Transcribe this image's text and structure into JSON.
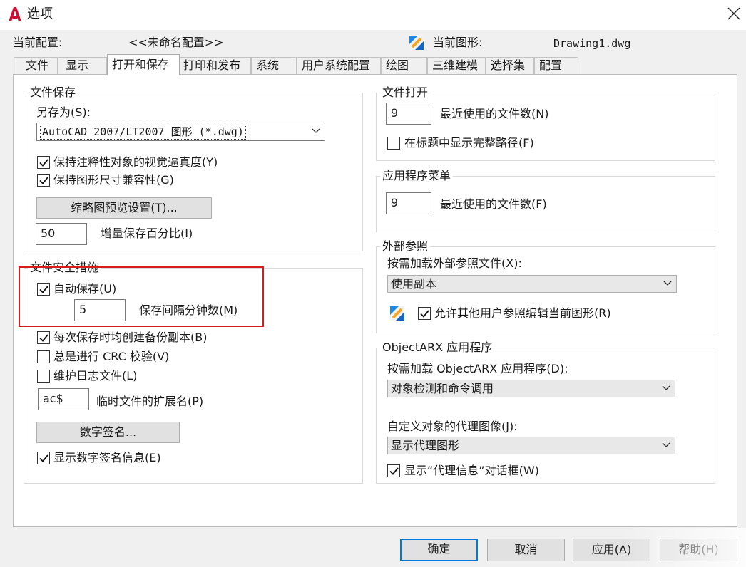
{
  "window": {
    "title": "选项",
    "close_icon": "close-icon"
  },
  "header": {
    "current_profile_label": "当前配置:",
    "current_profile_value": "<<未命名配置>>",
    "current_drawing_label": "当前图形:",
    "current_drawing_value": "Drawing1.dwg"
  },
  "tabs": [
    {
      "label": "文件"
    },
    {
      "label": "显示"
    },
    {
      "label": "打开和保存",
      "active": true
    },
    {
      "label": "打印和发布"
    },
    {
      "label": "系统"
    },
    {
      "label": "用户系统配置"
    },
    {
      "label": "绘图"
    },
    {
      "label": "三维建模"
    },
    {
      "label": "选择集"
    },
    {
      "label": "配置"
    }
  ],
  "file_save": {
    "title": "文件保存",
    "save_as_label": "另存为(S):",
    "save_as_value": "AutoCAD 2007/LT2007 图形 (*.dwg)",
    "maintain_visual_fidelity": {
      "label": "保持注释性对象的视觉逼真度(Y)",
      "checked": true
    },
    "maintain_drawing_size": {
      "label": "保持图形尺寸兼容性(G)",
      "checked": true
    },
    "thumbnail_button": "缩略图预览设置(T)...",
    "incremental_value": "50",
    "incremental_label": "增量保存百分比(I)"
  },
  "file_safety": {
    "title": "文件安全措施",
    "autosave": {
      "label": "自动保存(U)",
      "checked": true
    },
    "interval_value": "5",
    "interval_label": "保存间隔分钟数(M)",
    "backup_copy": {
      "label": "每次保存时均创建备份副本(B)",
      "checked": true
    },
    "crc_check": {
      "label": "总是进行 CRC 校验(V)",
      "checked": false
    },
    "log_file": {
      "label": "维护日志文件(L)",
      "checked": false
    },
    "temp_ext_value": "ac$",
    "temp_ext_label": "临时文件的扩展名(P)",
    "digital_signature_button": "数字签名...",
    "show_signature_info": {
      "label": "显示数字签名信息(E)",
      "checked": true
    }
  },
  "file_open": {
    "title": "文件打开",
    "recent_count_value": "9",
    "recent_count_label": "最近使用的文件数(N)",
    "full_path": {
      "label": "在标题中显示完整路径(F)",
      "checked": false
    }
  },
  "app_menu": {
    "title": "应用程序菜单",
    "recent_count_value": "9",
    "recent_count_label": "最近使用的文件数(F)"
  },
  "xref": {
    "title": "外部参照",
    "demand_load_label": "按需加载外部参照文件(X):",
    "demand_load_value": "使用副本",
    "allow_edit": {
      "label": "允许其他用户参照编辑当前图形(R)",
      "checked": true
    }
  },
  "objectarx": {
    "title": "ObjectARX 应用程序",
    "demand_load_label": "按需加载 ObjectARX 应用程序(D):",
    "demand_load_value": "对象检测和命令调用",
    "proxy_images_label": "自定义对象的代理图像(J):",
    "proxy_images_value": "显示代理图形",
    "show_proxy_dialog": {
      "label": "显示“代理信息”对话框(W)",
      "checked": true
    }
  },
  "footer": {
    "ok": "确定",
    "cancel": "取消",
    "apply": "应用(A)",
    "help": "帮助(H)"
  },
  "colors": {
    "accent": "#0078d7",
    "highlight_red": "#d61c1c",
    "autocad_red": "#c8102e"
  }
}
